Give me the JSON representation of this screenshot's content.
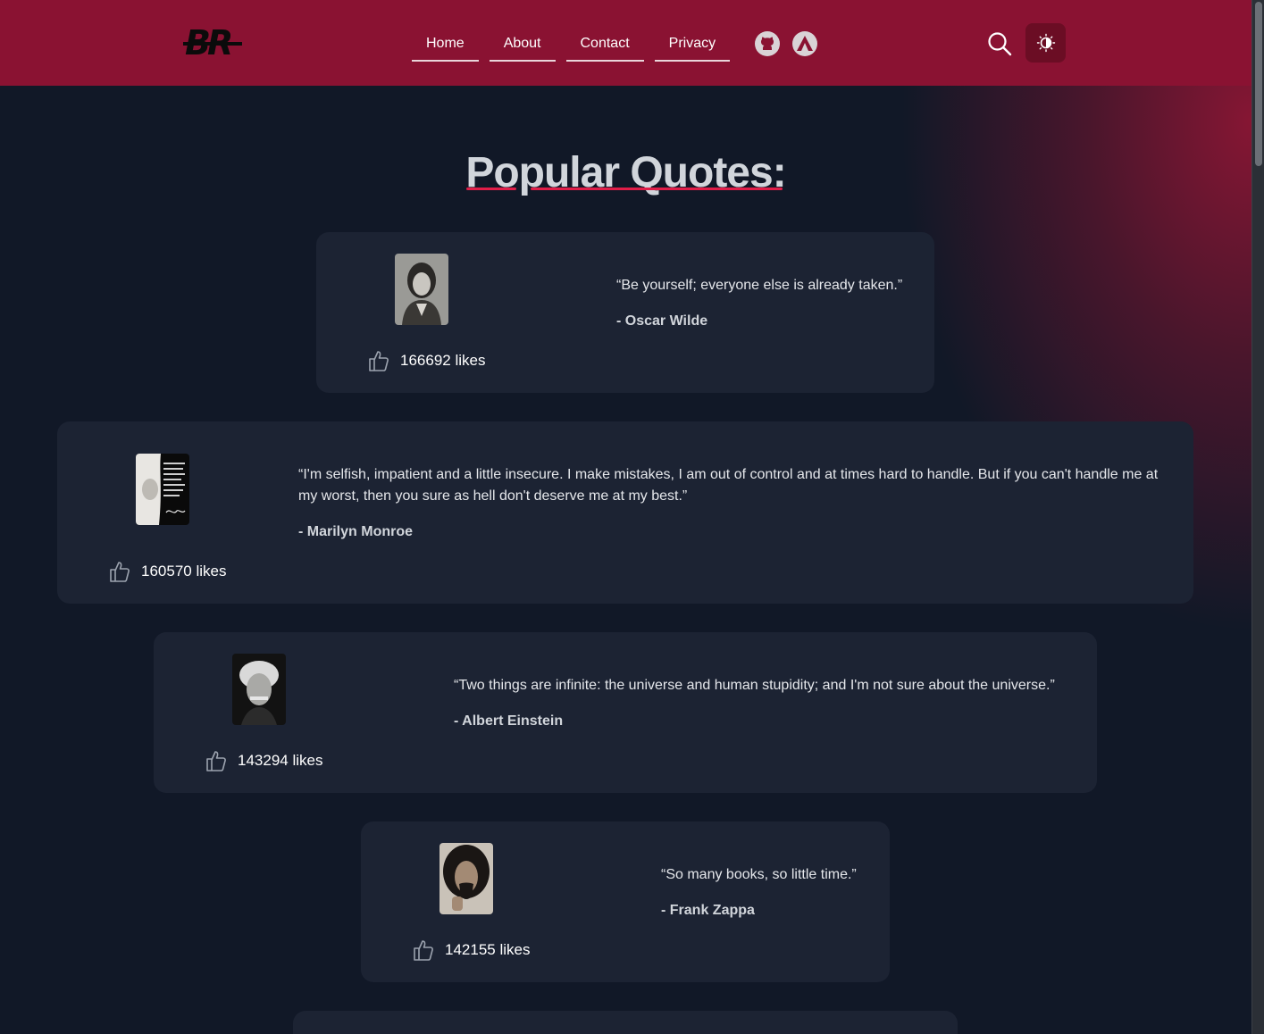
{
  "header": {
    "logo_text": "BR",
    "nav": [
      {
        "label": "Home"
      },
      {
        "label": "About"
      },
      {
        "label": "Contact"
      },
      {
        "label": "Privacy"
      }
    ],
    "icons": [
      "github-icon",
      "site-icon",
      "search-icon",
      "theme-toggle-icon"
    ]
  },
  "main": {
    "title": "Popular Quotes:",
    "quotes": [
      {
        "text": "“Be yourself; everyone else is already taken.”",
        "author": "- Oscar Wilde",
        "likes": "166692 likes"
      },
      {
        "text": "“I'm selfish, impatient and a little insecure. I make mistakes, I am out of control and at times hard to handle. But if you can't handle me at my worst, then you sure as hell don't deserve me at my best.”",
        "author": "- Marilyn Monroe",
        "likes": "160570 likes"
      },
      {
        "text": "“Two things are infinite: the universe and human stupidity; and I'm not sure about the universe.”",
        "author": "- Albert Einstein",
        "likes": "143294 likes"
      },
      {
        "text": "“So many books, so little time.”",
        "author": "- Frank Zappa",
        "likes": "142155 likes"
      }
    ]
  },
  "colors": {
    "header_bg": "#8a1232",
    "page_bg": "#111827",
    "card_bg": "#1c2333",
    "accent": "#e11d48"
  }
}
